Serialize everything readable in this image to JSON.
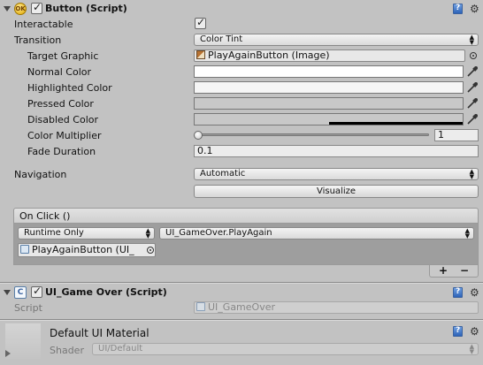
{
  "button_component": {
    "title": "Button (Script)",
    "icon": "ok-icon",
    "enabled": true,
    "fields": {
      "interactable": {
        "label": "Interactable",
        "checked": true
      },
      "transition": {
        "label": "Transition",
        "value": "Color Tint"
      },
      "target_graphic": {
        "label": "Target Graphic",
        "value": "PlayAgainButton (Image)"
      },
      "normal_color": {
        "label": "Normal Color",
        "color": "#ffffff"
      },
      "highlighted_color": {
        "label": "Highlighted Color",
        "color": "#f5f5f5"
      },
      "pressed_color": {
        "label": "Pressed Color",
        "color": "#c8c8c8"
      },
      "disabled_color": {
        "label": "Disabled Color",
        "color": "#c8c8c8"
      },
      "color_multiplier": {
        "label": "Color Multiplier",
        "value": "1",
        "slider_fraction": 0.0
      },
      "fade_duration": {
        "label": "Fade Duration",
        "value": "0.1"
      },
      "navigation": {
        "label": "Navigation",
        "value": "Automatic"
      },
      "visualize": {
        "label": "Visualize"
      }
    },
    "on_click": {
      "header": "On Click ()",
      "runtime": "Runtime Only",
      "function": "UI_GameOver.PlayAgain",
      "object": "PlayAgainButton (UI_",
      "add": "+",
      "remove": "−"
    }
  },
  "game_over_component": {
    "title": "UI_Game Over (Script)",
    "script_label": "Script",
    "script_value": "UI_GameOver"
  },
  "material": {
    "title": "Default UI Material",
    "shader_label": "Shader",
    "shader_value": "UI/Default"
  },
  "colors": {
    "background": "#c2c2c2",
    "panel_dark": "#9e9e9e",
    "accent_blue": "#2d63b8"
  }
}
